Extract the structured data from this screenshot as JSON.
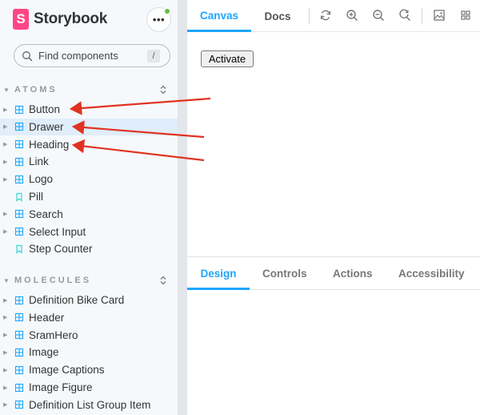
{
  "brand": {
    "logo_letter": "S",
    "name": "Storybook"
  },
  "menu": {
    "label": "•••",
    "status_color": "#66bf3c"
  },
  "search": {
    "placeholder": "Find components",
    "shortcut": "/"
  },
  "sidebar": {
    "groups": [
      {
        "title": "ATOMS",
        "items": [
          {
            "label": "Button",
            "kind": "component"
          },
          {
            "label": "Drawer",
            "kind": "component",
            "selected": true
          },
          {
            "label": "Heading",
            "kind": "component"
          },
          {
            "label": "Link",
            "kind": "component"
          },
          {
            "label": "Logo",
            "kind": "component"
          },
          {
            "label": "Pill",
            "kind": "story"
          },
          {
            "label": "Search",
            "kind": "component"
          },
          {
            "label": "Select Input",
            "kind": "component"
          },
          {
            "label": "Step Counter",
            "kind": "story"
          }
        ]
      },
      {
        "title": "MOLECULES",
        "items": [
          {
            "label": "Definition Bike Card",
            "kind": "component"
          },
          {
            "label": "Header",
            "kind": "component"
          },
          {
            "label": "SramHero",
            "kind": "component"
          },
          {
            "label": "Image",
            "kind": "component"
          },
          {
            "label": "Image Captions",
            "kind": "component"
          },
          {
            "label": "Image Figure",
            "kind": "component"
          },
          {
            "label": "Definition List Group Item",
            "kind": "component"
          }
        ]
      }
    ]
  },
  "toolbar": {
    "tabs": [
      "Canvas",
      "Docs"
    ],
    "active_tab": "Canvas",
    "tools": [
      "refresh-icon",
      "zoom-in-icon",
      "zoom-out-icon",
      "zoom-reset-icon",
      "background-icon",
      "grid-icon"
    ]
  },
  "preview": {
    "button_label": "Activate"
  },
  "addons": {
    "tabs": [
      "Design",
      "Controls",
      "Actions",
      "Accessibility"
    ],
    "active_tab": "Design"
  },
  "colors": {
    "accent": "#1ea7fd",
    "brand": "#ff4785",
    "annotation_arrow": "#e0321f"
  }
}
